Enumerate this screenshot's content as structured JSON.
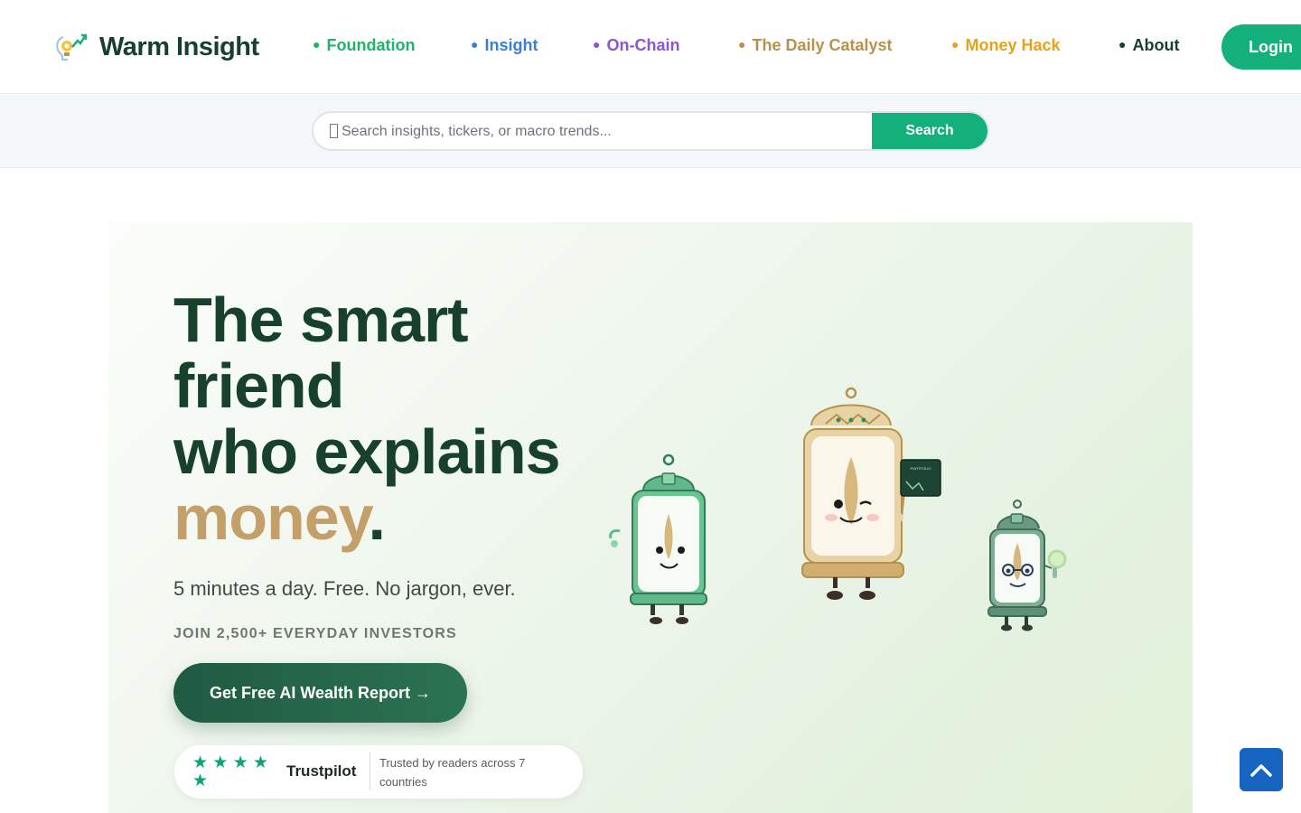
{
  "brand": {
    "name": "Warm Insight"
  },
  "nav": {
    "items": [
      {
        "label": "Foundation",
        "color": "#1fb36c"
      },
      {
        "label": "Insight",
        "color": "#3b7fd4"
      },
      {
        "label": "On-Chain",
        "color": "#8a55d6"
      },
      {
        "label": "The Daily Catalyst",
        "color": "#b8924d"
      },
      {
        "label": "Money Hack",
        "color": "#e6a21c"
      },
      {
        "label": "About",
        "color": "#163f2e"
      }
    ],
    "login_label": "Login"
  },
  "search": {
    "placeholder": "Search insights, tickers, or macro trends...",
    "button_label": "Search"
  },
  "hero": {
    "headline_line1": "The smart",
    "headline_line2": "friend",
    "headline_line3": "who explains",
    "headline_gold": "money",
    "headline_end": ".",
    "subhead": "5 minutes a day. Free. No jargon, ever.",
    "join_text": "JOIN 2,500+ EVERYDAY INVESTORS",
    "cta_label": "Get Free AI Wealth Report →",
    "illustration_board_label": "PORTFOLIO"
  },
  "trust": {
    "stars": "★ ★ ★ ★ ★",
    "provider": "Trustpilot",
    "text": "Trusted by readers across 7 countries"
  },
  "colors": {
    "accent": "#13b07c",
    "dark_green": "#17402d",
    "gold": "#c3a06a",
    "scroll_button": "#1565c0"
  }
}
